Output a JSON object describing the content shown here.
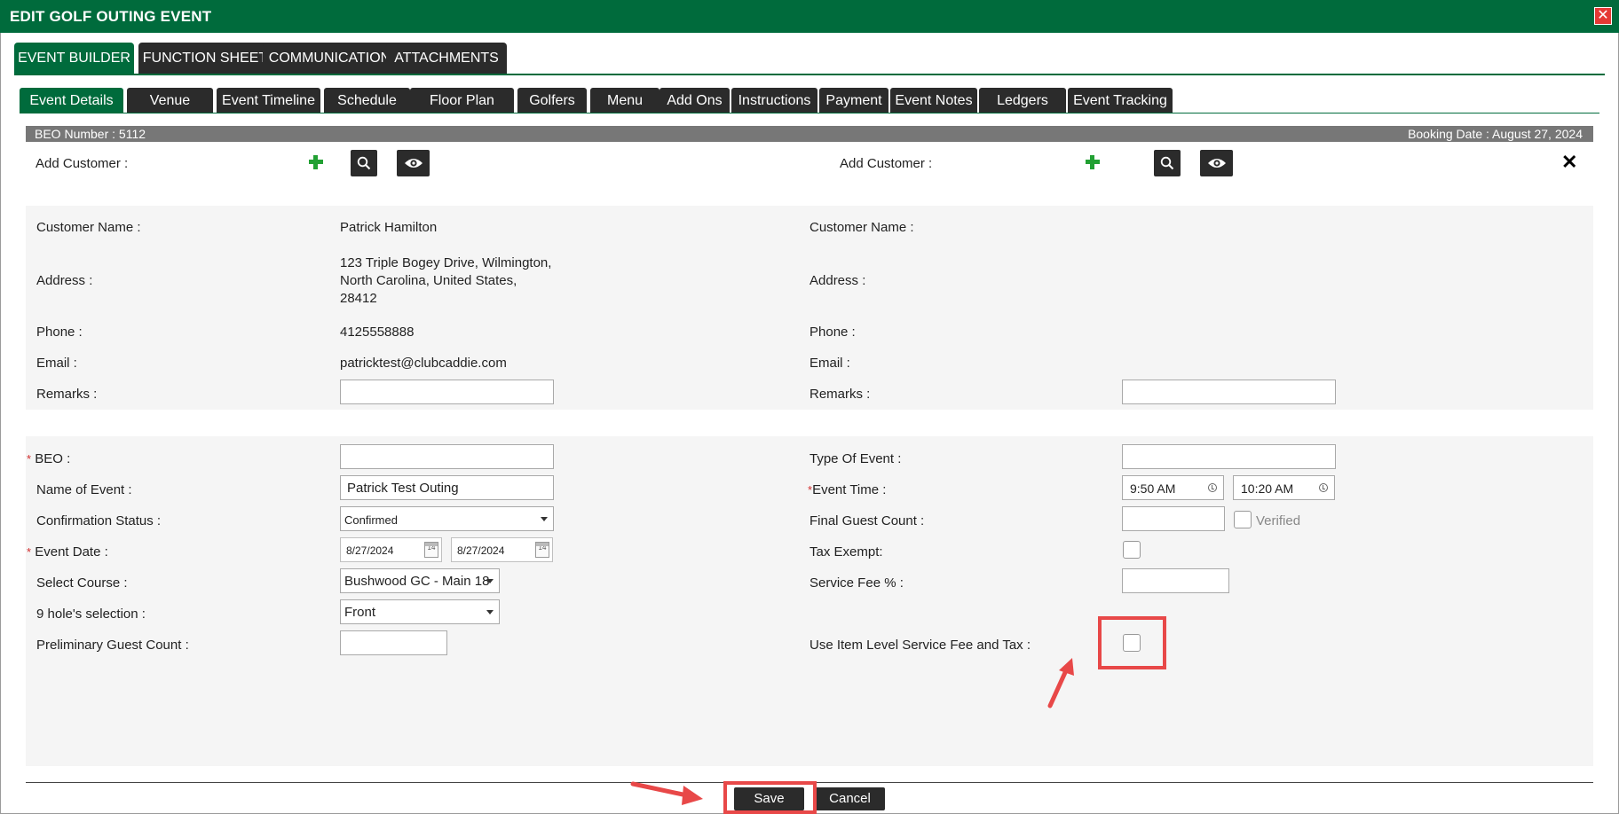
{
  "window": {
    "title": "EDIT GOLF OUTING EVENT",
    "close_symbol": "✕"
  },
  "main_tabs": [
    {
      "label": "EVENT BUILDER",
      "active": true
    },
    {
      "label": "FUNCTION SHEET",
      "active": false
    },
    {
      "label": "COMMUNICATION",
      "active": false
    },
    {
      "label": "ATTACHMENTS",
      "active": false
    }
  ],
  "sub_tabs": [
    {
      "label": "Event Details",
      "active": true
    },
    {
      "label": "Venue"
    },
    {
      "label": "Event Timeline"
    },
    {
      "label": "Schedule"
    },
    {
      "label": "Floor Plan"
    },
    {
      "label": "Golfers"
    },
    {
      "label": "Menu"
    },
    {
      "label": "Add Ons"
    },
    {
      "label": "Instructions"
    },
    {
      "label": "Payment"
    },
    {
      "label": "Event Notes"
    },
    {
      "label": "Ledgers"
    },
    {
      "label": "Event Tracking"
    }
  ],
  "beo_bar": {
    "beo_number": "BEO Number : 5112",
    "booking_date": "Booking Date : August 27, 2024"
  },
  "customer_left": {
    "add_label": "Add Customer :",
    "name_label": "Customer Name :",
    "name": "Patrick Hamilton",
    "address_label": "Address :",
    "address_line1": "123 Triple Bogey Drive, Wilmington,",
    "address_line2": "North Carolina, United States,",
    "address_line3": "28412",
    "phone_label": "Phone :",
    "phone": "4125558888",
    "email_label": "Email :",
    "email": "patricktest@clubcaddie.com",
    "remarks_label": "Remarks :",
    "remarks_value": ""
  },
  "customer_right": {
    "add_label": "Add Customer :",
    "name_label": "Customer Name :",
    "address_label": "Address :",
    "phone_label": "Phone :",
    "email_label": "Email :",
    "remarks_label": "Remarks  :",
    "remarks_value": "",
    "remove_symbol": "✕"
  },
  "event_form": {
    "required_mark": "*",
    "beo_label": "BEO :",
    "beo_value": "",
    "name_label": "Name of Event :",
    "name_value": "Patrick Test Outing",
    "confirmation_label": "Confirmation Status :",
    "confirmation_value": "Confirmed",
    "event_date_label": "Event Date :",
    "event_date_start": "8/27/2024",
    "event_date_end": "8/27/2024",
    "calendar_day": "14",
    "course_label": "Select Course :",
    "course_value": "Bushwood GC - Main 18",
    "nine_hole_label": "9 hole's selection :",
    "nine_hole_value": "Front",
    "prelim_count_label": "Preliminary Guest Count :",
    "prelim_count_value": "",
    "type_label": "Type Of Event :",
    "type_value": "",
    "event_time_label": "Event Time :",
    "event_time_start": "9:50 AM",
    "event_time_end": "10:20 AM",
    "final_count_label": "Final Guest Count :",
    "final_count_value": "",
    "verified_label": "Verified",
    "verified_checked": false,
    "tax_exempt_label": "Tax Exempt:",
    "tax_exempt_checked": false,
    "service_fee_label": "Service Fee % :",
    "service_fee_value": "",
    "item_level_label": "Use Item Level Service Fee and Tax :",
    "item_level_checked": false
  },
  "actions": {
    "save_label": "Save",
    "cancel_label": "Cancel"
  },
  "colors": {
    "brand_green": "#006b3c",
    "tab_dark": "#2b2b2b",
    "annotation_red": "#e84848",
    "plus_green": "#22a033"
  }
}
